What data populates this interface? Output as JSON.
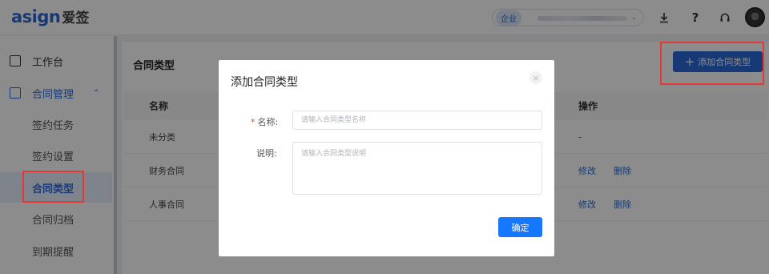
{
  "header": {
    "logo_latin": "asign",
    "logo_cn": "爱签",
    "org_tag": "企业",
    "org_name": "",
    "icons": [
      "download-icon",
      "help-icon",
      "headset-icon",
      "avatar"
    ]
  },
  "sidebar": {
    "workbench": "工作台",
    "contract_mgmt": "合同管理",
    "sub_items": [
      "签约任务",
      "签约设置",
      "合同类型",
      "合同归档",
      "到期提醒"
    ]
  },
  "main": {
    "title": "合同类型",
    "add_button": "添加合同类型",
    "table": {
      "headers": {
        "name": "名称",
        "ops": "操作"
      },
      "rows": [
        {
          "name": "未分类",
          "op": "-"
        },
        {
          "name": "财务合同",
          "edit": "修改",
          "delete": "删除"
        },
        {
          "name": "人事合同",
          "edit": "修改",
          "delete": "删除"
        }
      ]
    }
  },
  "modal": {
    "title": "添加合同类型",
    "close": "×",
    "name_label": "名称:",
    "name_placeholder": "请输入合同类型名称",
    "desc_label": "说明:",
    "desc_placeholder": "请输入合同类型说明",
    "confirm": "确定"
  },
  "colors": {
    "primary": "#2b6bd7",
    "confirm": "#1677ff",
    "highlight": "#e53935"
  }
}
